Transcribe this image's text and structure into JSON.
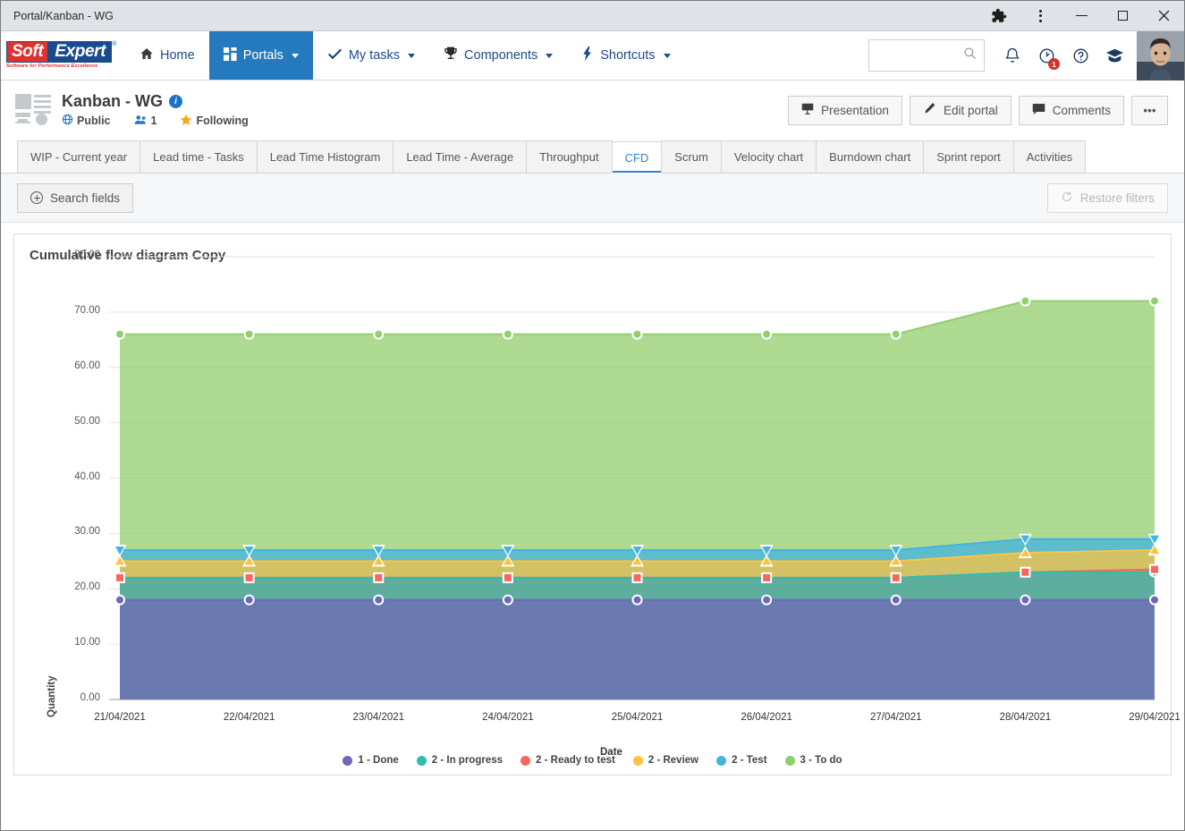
{
  "window": {
    "title": "Portal/Kanban - WG",
    "controls": {
      "extensions": "puzzle-icon",
      "menu": "kebab-icon",
      "minimize": "minimize-icon",
      "maximize": "maximize-icon",
      "close": "close-icon"
    }
  },
  "nav": {
    "brand": {
      "soft": "Soft",
      "expert": "Expert",
      "tagline": "Software for Performance Excellence",
      "reg": "®"
    },
    "items": [
      {
        "label": "Home",
        "icon": "home-icon",
        "caret": false,
        "active": false
      },
      {
        "label": "Portals",
        "icon": "portals-grid-icon",
        "caret": true,
        "active": true
      },
      {
        "label": "My tasks",
        "icon": "check-icon",
        "caret": true,
        "active": false
      },
      {
        "label": "Components",
        "icon": "trophy-icon",
        "caret": true,
        "active": false
      },
      {
        "label": "Shortcuts",
        "icon": "bolt-icon",
        "caret": true,
        "active": false
      }
    ],
    "search": {
      "value": "",
      "placeholder": "",
      "icon": "search-icon"
    },
    "icons": [
      {
        "name": "bell-icon",
        "badge": ""
      },
      {
        "name": "clock-alert-icon",
        "badge": "1"
      },
      {
        "name": "help-icon",
        "badge": ""
      },
      {
        "name": "academy-icon",
        "badge": ""
      }
    ]
  },
  "page": {
    "title": "Kanban - WG",
    "info_icon": "info-icon",
    "visibility": "Public",
    "members_count": "1",
    "follow_state": "Following",
    "actions": [
      {
        "label": "Presentation",
        "icon": "presentation-icon"
      },
      {
        "label": "Edit portal",
        "icon": "pencil-icon"
      },
      {
        "label": "Comments",
        "icon": "comment-icon"
      }
    ],
    "more_label": "•••"
  },
  "tabs": [
    {
      "label": "WIP - Current year",
      "active": false
    },
    {
      "label": "Lead time - Tasks",
      "active": false
    },
    {
      "label": "Lead Time Histogram",
      "active": false
    },
    {
      "label": "Lead Time - Average",
      "active": false
    },
    {
      "label": "Throughput",
      "active": false
    },
    {
      "label": "CFD",
      "active": true
    },
    {
      "label": "Scrum",
      "active": false
    },
    {
      "label": "Velocity chart",
      "active": false
    },
    {
      "label": "Burndown chart",
      "active": false
    },
    {
      "label": "Sprint report",
      "active": false
    },
    {
      "label": "Activities",
      "active": false
    }
  ],
  "filterbar": {
    "search_fields_label": "Search fields",
    "restore_filters_label": "Restore filters",
    "restore_icon": "restore-circular-arrow-icon",
    "restore_disabled": true
  },
  "chart_data": {
    "type": "area",
    "title": "Cumulative flow diagram Copy",
    "xlabel": "Date",
    "ylabel": "Quantity",
    "grid": true,
    "legend_position": "bottom",
    "stacked": true,
    "ylim": [
      0,
      80
    ],
    "yticks": [
      "0.00",
      "10.00",
      "20.00",
      "30.00",
      "40.00",
      "50.00",
      "60.00",
      "70.00",
      "80.00"
    ],
    "categories": [
      "21/04/2021",
      "22/04/2021",
      "23/04/2021",
      "24/04/2021",
      "25/04/2021",
      "26/04/2021",
      "27/04/2021",
      "28/04/2021",
      "29/04/2021"
    ],
    "series": [
      {
        "name": "1 - Done",
        "color": "#6f68b8",
        "marker": "circle",
        "values": [
          18,
          18,
          18,
          18,
          18,
          18,
          18,
          18,
          18
        ],
        "cumulative": [
          18,
          18,
          18,
          18,
          18,
          18,
          18,
          18,
          18
        ]
      },
      {
        "name": "2 - In progress",
        "color": "#2ebdb0",
        "marker": "circle",
        "values": [
          4,
          4,
          4,
          4,
          4,
          4,
          4,
          5,
          5
        ],
        "cumulative": [
          22,
          22,
          22,
          22,
          22,
          22,
          22,
          23,
          23
        ]
      },
      {
        "name": "2 - Ready to test",
        "color": "#f4685e",
        "marker": "square",
        "values": [
          0,
          0,
          0,
          0,
          0,
          0,
          0,
          0,
          0.5
        ],
        "cumulative": [
          22,
          22,
          22,
          22,
          22,
          22,
          22,
          23,
          23.5
        ]
      },
      {
        "name": "2 - Review",
        "color": "#fbc343",
        "marker": "triangle-up",
        "values": [
          3,
          3,
          3,
          3,
          3,
          3,
          3,
          3.5,
          3.5
        ],
        "cumulative": [
          25,
          25,
          25,
          25,
          25,
          25,
          25,
          26.5,
          27
        ]
      },
      {
        "name": "2 - Test",
        "color": "#43b3e0",
        "marker": "triangle-down",
        "values": [
          2,
          2,
          2,
          2,
          2,
          2,
          2,
          2.5,
          2
        ],
        "cumulative": [
          27,
          27,
          27,
          27,
          27,
          27,
          27,
          29,
          29
        ]
      },
      {
        "name": "3 - To do",
        "color": "#93ce6e",
        "marker": "circle",
        "values": [
          39,
          39,
          39,
          39,
          39,
          39,
          39,
          43,
          43
        ],
        "cumulative": [
          66,
          66,
          66,
          66,
          66,
          66,
          66,
          72,
          72
        ]
      }
    ]
  }
}
